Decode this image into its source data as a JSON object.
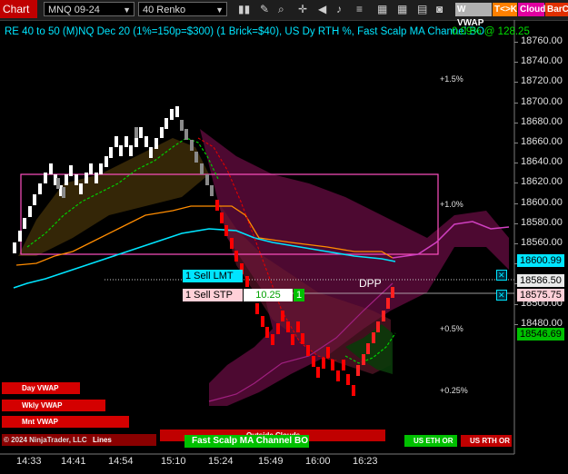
{
  "toolbar": {
    "title": "Chart",
    "instrument": "MNQ 09-24",
    "bar_type": "40 Renko",
    "btn_vwap": "W VWAP",
    "btn_tk": "T<>K",
    "btn_cloud": "Cloud",
    "btn_barco": "BarCo",
    "icons": [
      "bar-chart-icon",
      "pencil-icon",
      "zoom-icon",
      "crosshair-icon",
      "speaker-icon",
      "sound-icon",
      "lines-icon",
      "calendar-icon",
      "calendar2-icon",
      "template-icon",
      "camera-icon"
    ]
  },
  "header": {
    "text": "RE 40 to 50 (M)NQ Dec 20 (1%=150p=$300) (1 Brick=$40), US Dy RTH %, Fast Scalp MA Channel BO",
    "price_text": "0.09% @ 128.25",
    "partial_text": "0"
  },
  "pct_labels": [
    "+1.5%",
    "+1.0%",
    "+0.5%",
    "+0.25%"
  ],
  "price_axis": [
    "18760.00",
    "18740.00",
    "18720.00",
    "18700.00",
    "18680.00",
    "18660.00",
    "18640.00",
    "18620.00",
    "18600.00",
    "18580.00",
    "18560.00",
    "18540.00",
    "18520.00",
    "18500.00",
    "18480.00"
  ],
  "price_labels": {
    "current": "18600.99",
    "sell_lmt_price": "18586.50",
    "sell_stp_price": "18575.75",
    "lower": "18546.69"
  },
  "orders": {
    "sell_lmt": "1 Sell LMT",
    "sell_stp": "1 Sell STP",
    "stp_value": "10.25",
    "stp_qty": "1",
    "close_glyph": "✕"
  },
  "dpp": "DPP",
  "vwap_labels": [
    "Day VWAP",
    "Wkly VWAP",
    "Mnt VWAP"
  ],
  "bottom_labels": {
    "copyright": "© 2024 NinjaTrader, LLC",
    "lines": "Lines",
    "outside_clouds": "Outside Clouds",
    "fast_scalp": "Fast Scalp MA Channel BO",
    "us_eth": "US ETH OR",
    "us_rth": "US RTH OR"
  },
  "time_axis": [
    "14:33",
    "14:41",
    "14:54",
    "15:10",
    "15:24",
    "15:49",
    "16:00",
    "16:23"
  ],
  "colors": {
    "up_brick": "#ffffff",
    "down_brick": "#ff0000",
    "cyan_line": "#00e5ff",
    "orange_line": "#ff8c00",
    "magenta_line": "#d040c0",
    "green_line": "#00ff00",
    "price_green": "#00c000"
  }
}
